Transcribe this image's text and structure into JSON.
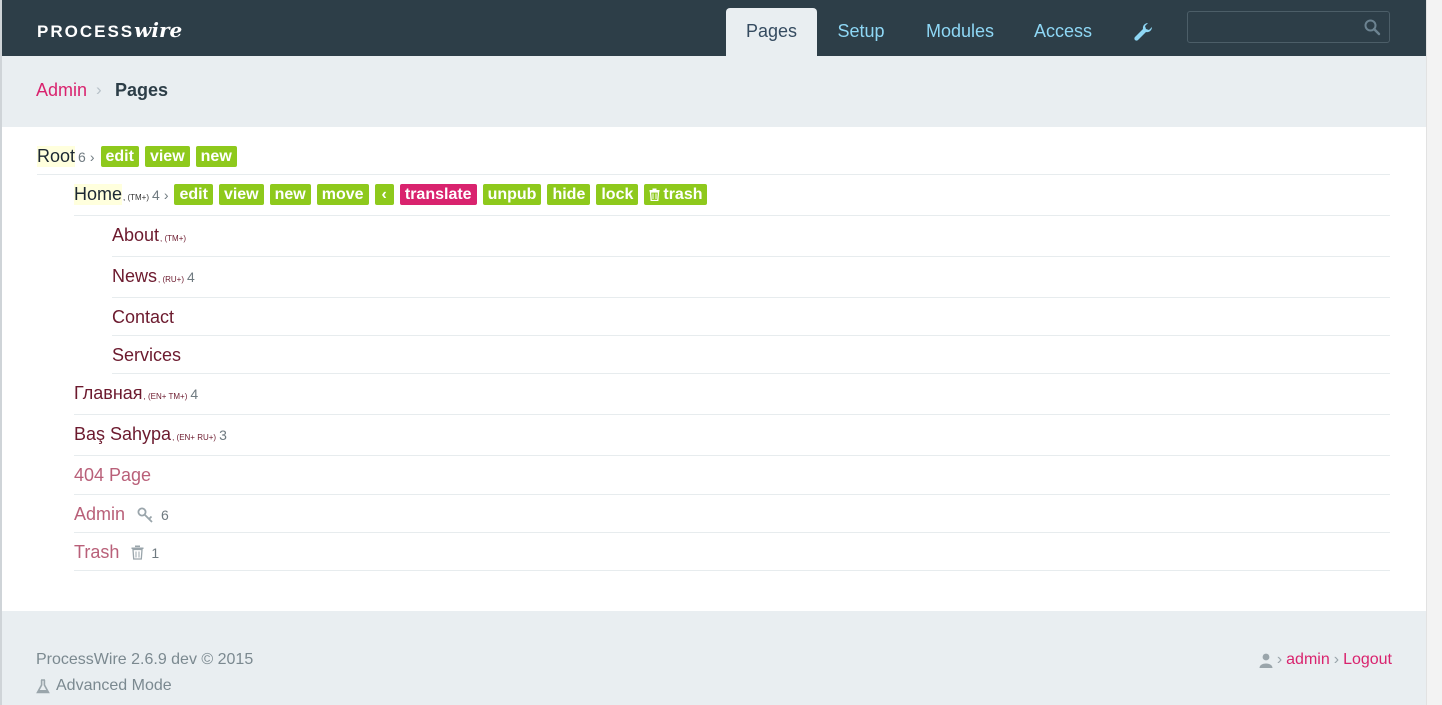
{
  "logo": {
    "process": "PROCESS",
    "wire": "wire"
  },
  "nav": {
    "tabs": [
      {
        "label": "Pages",
        "active": true
      },
      {
        "label": "Setup"
      },
      {
        "label": "Modules"
      },
      {
        "label": "Access"
      }
    ],
    "tools_icon": "wrench-icon",
    "search": {
      "placeholder": "",
      "icon": "search-icon"
    }
  },
  "breadcrumb": {
    "root": "Admin",
    "separator": "›",
    "current": "Pages"
  },
  "tree": {
    "root": {
      "name": "Root",
      "count": "6",
      "chevron": "›",
      "actions": [
        "edit",
        "view",
        "new"
      ]
    },
    "home": {
      "name": "Home",
      "langs": ", (TM+)",
      "count": "4",
      "chevron": "›",
      "actions": [
        "edit",
        "view",
        "new",
        "move",
        "‹",
        "translate",
        "unpub",
        "hide",
        "lock",
        "trash"
      ]
    },
    "children": [
      {
        "name": "About",
        "langs": ", (TM+)",
        "count": ""
      },
      {
        "name": "News",
        "langs": ", (RU+)",
        "count": "4"
      },
      {
        "name": "Contact",
        "langs": "",
        "count": ""
      },
      {
        "name": "Services",
        "langs": "",
        "count": ""
      }
    ],
    "level1": [
      {
        "name": "Главная",
        "langs": ", (EN+ TM+)",
        "count": "4"
      },
      {
        "name": "Baş Sahypa",
        "langs": ", (EN+ RU+)",
        "count": "3"
      },
      {
        "name": "404 Page",
        "langs": "",
        "count": ""
      },
      {
        "name": "Admin",
        "langs": "",
        "count": "6",
        "icon": "key-icon"
      },
      {
        "name": "Trash",
        "langs": "",
        "count": "1",
        "icon": "trash-icon"
      }
    ]
  },
  "footer": {
    "version": "ProcessWire 2.6.9 dev © 2015",
    "advanced": "Advanced Mode",
    "user": "admin",
    "logout": "Logout",
    "separator": "›"
  },
  "colors": {
    "brand_pink": "#d9236e",
    "action_green": "#8ec91c",
    "masthead": "#2d3e48",
    "band": "#e9eef1",
    "nav_link": "#8ed7f5"
  }
}
